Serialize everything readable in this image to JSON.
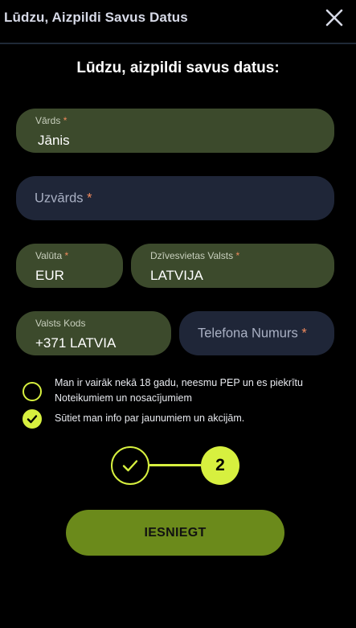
{
  "header": {
    "title": "Lūdzu, Aizpildi Savus Datus",
    "close_icon": "close-icon"
  },
  "form": {
    "heading": "Lūdzu, aizpildi savus datus:",
    "required_mark": "*",
    "first_name": {
      "label": "Vārds",
      "value": "Jānis"
    },
    "last_name": {
      "placeholder": "Uzvārds",
      "value": ""
    },
    "currency": {
      "label": "Valūta",
      "value": "EUR"
    },
    "country": {
      "label": "Dzīvesvietas Valsts",
      "value": "LATVIJA"
    },
    "country_code": {
      "label": "Valsts Kods",
      "value": "+371 LATVIA"
    },
    "phone": {
      "placeholder": "Telefona Numurs",
      "value": ""
    },
    "consents": [
      {
        "text": "Man ir vairāk nekā 18 gadu, neesmu PEP un es piekrītu Noteikumiem un nosacījumiem",
        "checked": false
      },
      {
        "text": "Sūtiet man info par jaunumiem un akcijām.",
        "checked": true
      }
    ],
    "stepper": {
      "completed_icon": "checkmark-icon",
      "current_step": "2"
    },
    "submit_label": "IESNIEGT"
  },
  "colors": {
    "accent": "#d7f03f",
    "filled_field": "#3c4a2c",
    "empty_field": "#1f2638",
    "submit": "#6b8a1b",
    "required": "#f08a5d"
  }
}
